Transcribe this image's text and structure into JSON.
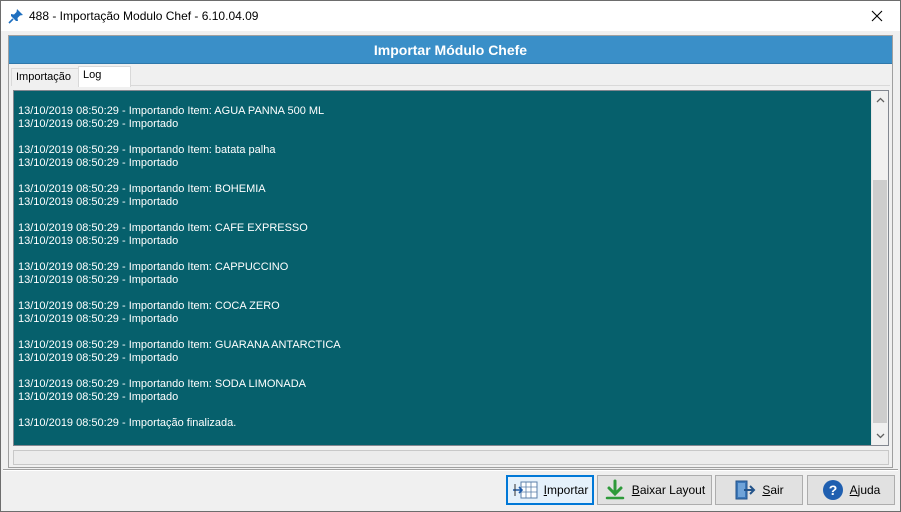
{
  "window": {
    "title": "488 - Importação Modulo Chef - 6.10.04.09"
  },
  "header": {
    "title": "Importar Módulo Chefe"
  },
  "tabs": [
    {
      "label": "Importação",
      "active": false
    },
    {
      "label": "Log",
      "active": true
    }
  ],
  "log": {
    "background": "#06606c",
    "lines": [
      "13/10/2019 08:50:29 - Importando Item: AGUA PANNA 500 ML",
      "13/10/2019 08:50:29 - Importado",
      "",
      "13/10/2019 08:50:29 - Importando Item: batata palha",
      "13/10/2019 08:50:29 - Importado",
      "",
      "13/10/2019 08:50:29 - Importando Item: BOHEMIA",
      "13/10/2019 08:50:29 - Importado",
      "",
      "13/10/2019 08:50:29 - Importando Item: CAFE EXPRESSO",
      "13/10/2019 08:50:29 - Importado",
      "",
      "13/10/2019 08:50:29 - Importando Item: CAPPUCCINO",
      "13/10/2019 08:50:29 - Importado",
      "",
      "13/10/2019 08:50:29 - Importando Item: COCA ZERO",
      "13/10/2019 08:50:29 - Importado",
      "",
      "13/10/2019 08:50:29 - Importando Item: GUARANA ANTARCTICA",
      "13/10/2019 08:50:29 - Importado",
      "",
      "13/10/2019 08:50:29 - Importando Item: SODA LIMONADA",
      "13/10/2019 08:50:29 - Importado",
      "",
      "13/10/2019 08:50:29 - Importação finalizada."
    ]
  },
  "buttons": {
    "importar": {
      "label_first": "I",
      "label_rest": "mportar",
      "icon": "import-icon"
    },
    "baixar_layout": {
      "label_first": "B",
      "label_rest": "aixar Layout",
      "icon": "download-arrow-icon"
    },
    "sair": {
      "label_first": "S",
      "label_rest": "air",
      "icon": "exit-door-icon"
    },
    "ajuda": {
      "label_first": "A",
      "label_rest": "juda",
      "icon": "help-icon"
    }
  },
  "colors": {
    "header_bg": "#3a8fc8",
    "accent": "#0078d7"
  }
}
